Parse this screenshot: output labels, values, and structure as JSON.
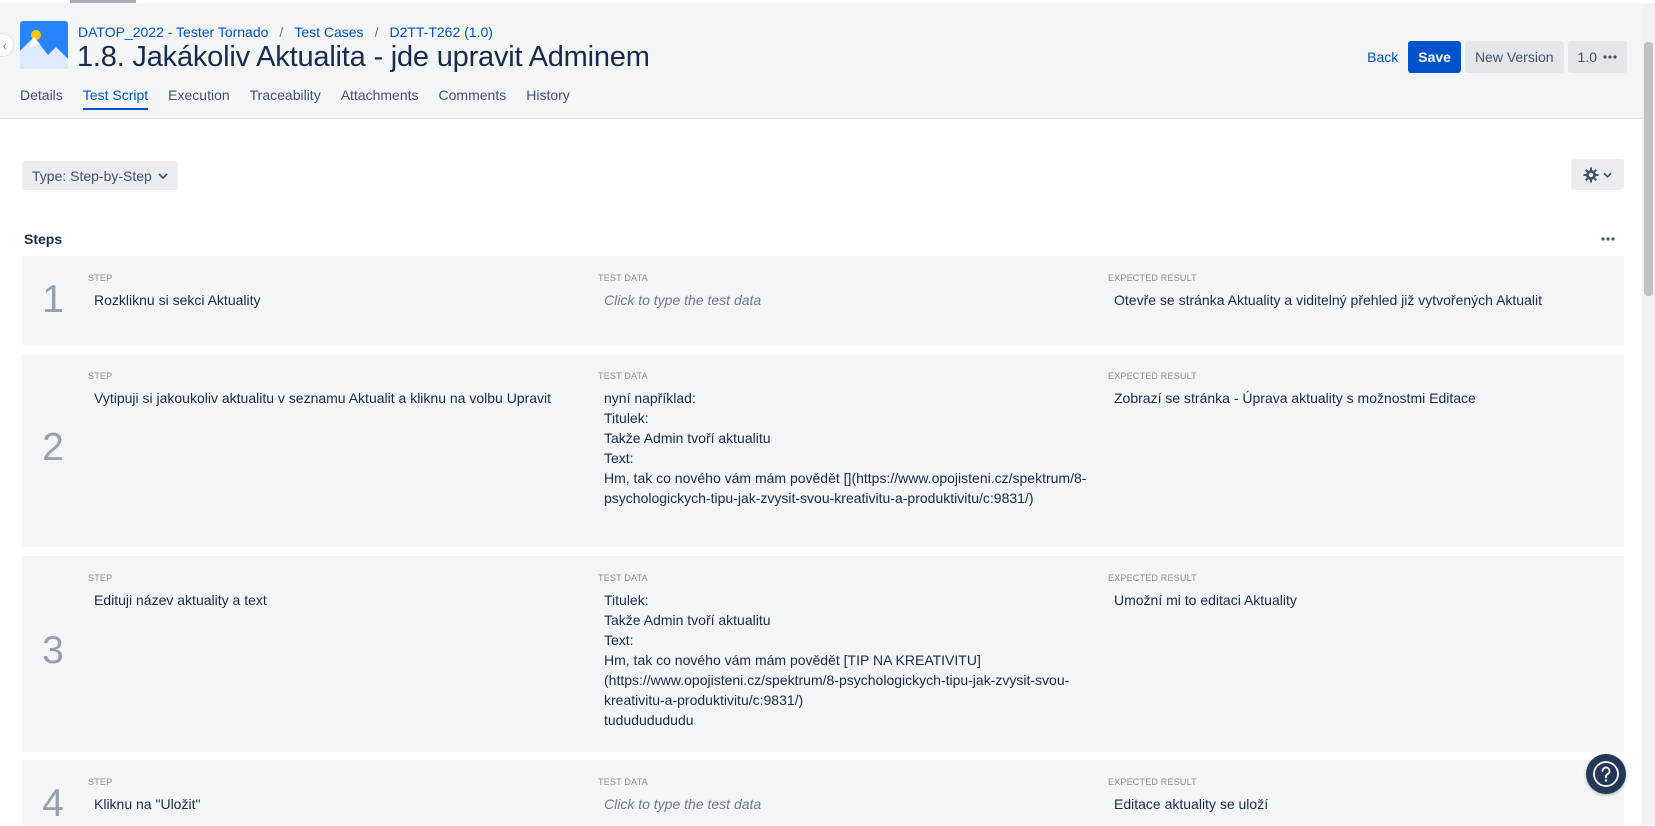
{
  "breadcrumb": {
    "project": "DATOP_2022 - Tester Tornado",
    "section": "Test Cases",
    "key": "D2TT-T262 (1.0)"
  },
  "title": "1.8. Jakákoliv Aktualita - jde upravit Adminem",
  "actions": {
    "back": "Back",
    "save": "Save",
    "new_version": "New Version",
    "version": "1.0"
  },
  "tabs": [
    {
      "label": "Details"
    },
    {
      "label": "Test Script",
      "active": true
    },
    {
      "label": "Execution"
    },
    {
      "label": "Traceability"
    },
    {
      "label": "Attachments"
    },
    {
      "label": "Comments"
    },
    {
      "label": "History"
    }
  ],
  "type_select": "Type: Step-by-Step",
  "steps_title": "Steps",
  "column_labels": {
    "step": "STEP",
    "test_data": "TEST DATA",
    "expected_result": "EXPECTED RESULT"
  },
  "steps": [
    {
      "number": "1",
      "step": "Rozkliknu si sekci Aktuality",
      "test_data": "Click to type the test data",
      "expected_result": "Otevře se stránka Aktuality a viditelný přehled již vytvořených Aktualit"
    },
    {
      "number": "2",
      "step": "Vytipuji si jakoukoliv aktualitu v seznamu Aktualit  a kliknu na volbu Upravit",
      "test_data": "nyní například:\nTitulek:\nTakže Admin tvoří aktualitu\nText:\nHm, tak co nového vám mám povědět [](https://www.opojisteni.cz/spektrum/8-psychologickych-tipu-jak-zvysit-svou-kreativitu-a-produktivitu/c:9831/)",
      "expected_result": "Zobrazí se stránka - Úprava aktuality s možnostmi Editace"
    },
    {
      "number": "3",
      "step": "Edituji název aktuality a text",
      "test_data": "Titulek:\nTakže Admin tvoří aktualitu\nText:\nHm, tak co nového vám mám povědět [TIP NA KREATIVITU](https://www.opojisteni.cz/spektrum/8-psychologickych-tipu-jak-zvysit-svou-kreativitu-a-produktivitu/c:9831/)\ntudududududu",
      "expected_result": "Umožní mi to editaci Aktuality"
    },
    {
      "number": "4",
      "step": "Kliknu na \"Uložit\"",
      "test_data": "Click to type the test data",
      "expected_result": "Editace aktuality se uloží"
    }
  ],
  "colors": {
    "primary": "#0052cc",
    "header_bg": "#f4f5f7",
    "row_bg": "#f4f5f7",
    "help_bg": "#253858"
  }
}
